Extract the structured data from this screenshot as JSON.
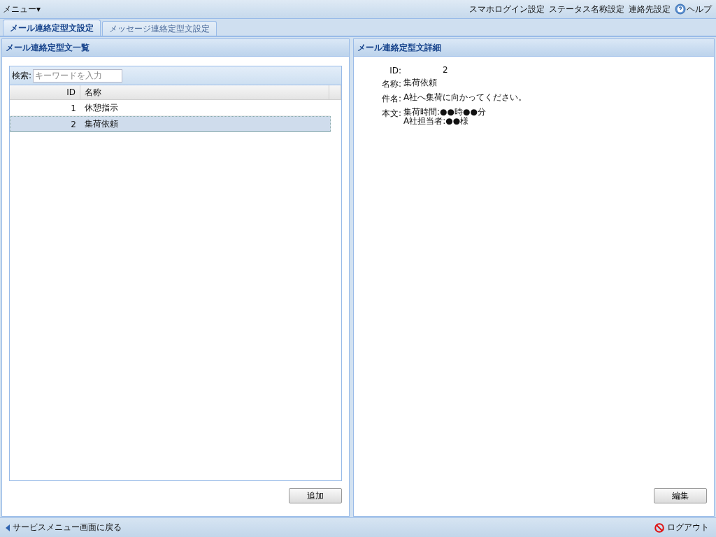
{
  "menu": {
    "label": "メニュー",
    "caret": "▾"
  },
  "top_links": [
    {
      "kind": "link",
      "label": "スマホログイン設定"
    },
    {
      "kind": "link",
      "label": "ステータス名称設定"
    },
    {
      "kind": "link",
      "label": "連絡先設定"
    },
    {
      "kind": "help",
      "label": "ヘルプ"
    }
  ],
  "tabs": [
    {
      "label": "メール連絡定型文設定",
      "selected": true
    },
    {
      "label": "メッセージ連絡定型文設定",
      "selected": false
    }
  ],
  "list_panel": {
    "title": "メール連絡定型文一覧",
    "search": {
      "label": "検索:",
      "placeholder": "キーワードを入力"
    },
    "columns": [
      "ID",
      "名称"
    ],
    "rows": [
      {
        "id": "1",
        "name": "休憩指示",
        "selected": false
      },
      {
        "id": "2",
        "name": "集荷依頼",
        "selected": true
      }
    ],
    "add_button": "追加"
  },
  "detail_panel": {
    "title": "メール連絡定型文詳細",
    "fields": [
      {
        "label": "ID:",
        "lines": [
          "2"
        ],
        "kind": "id"
      },
      {
        "label": "名称:",
        "lines": [
          "集荷依頼"
        ],
        "kind": "text"
      },
      {
        "label": "件名:",
        "lines": [
          "A社へ集荷に向かってください。"
        ],
        "kind": "text"
      },
      {
        "label": "本文:",
        "lines": [
          "集荷時間:●●時●●分",
          "A社担当者:●●様"
        ],
        "kind": "text"
      }
    ],
    "edit_button": "編集"
  },
  "footer": {
    "back": "サービスメニュー画面に戻る",
    "logout": "ログアウト"
  }
}
